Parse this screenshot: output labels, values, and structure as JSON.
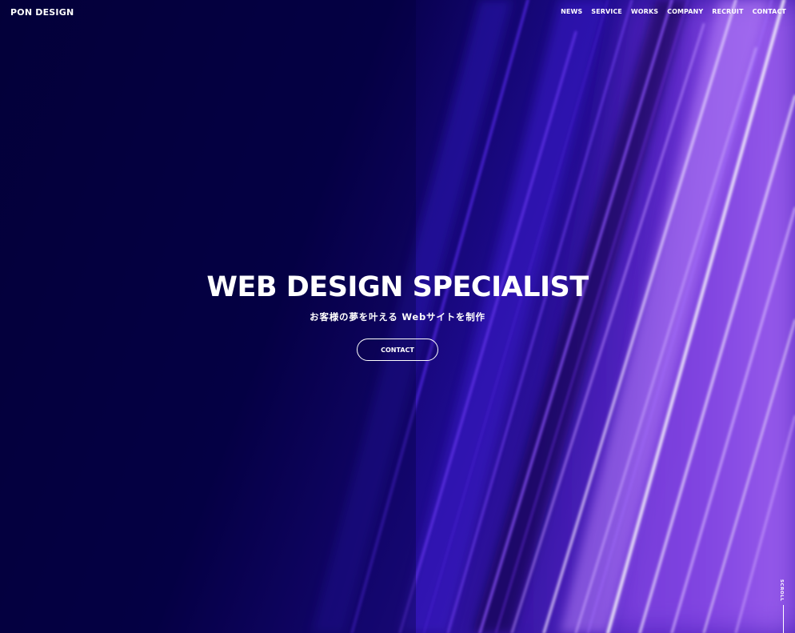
{
  "header": {
    "logo": "PON DESIGN",
    "nav": [
      "NEWS",
      "SERVICE",
      "WORKS",
      "COMPANY",
      "RECRUIT",
      "CONTACT"
    ]
  },
  "hero": {
    "title": "WEB DESIGN SPECIALIST",
    "subtitle": "お客様の夢を叶える Webサイトを制作",
    "cta_label": "CONTACT"
  },
  "scroll": {
    "label": "SCROLL"
  },
  "colors": {
    "background": "#05003a",
    "accent_purple": "#8a3cff",
    "text": "#ffffff"
  }
}
